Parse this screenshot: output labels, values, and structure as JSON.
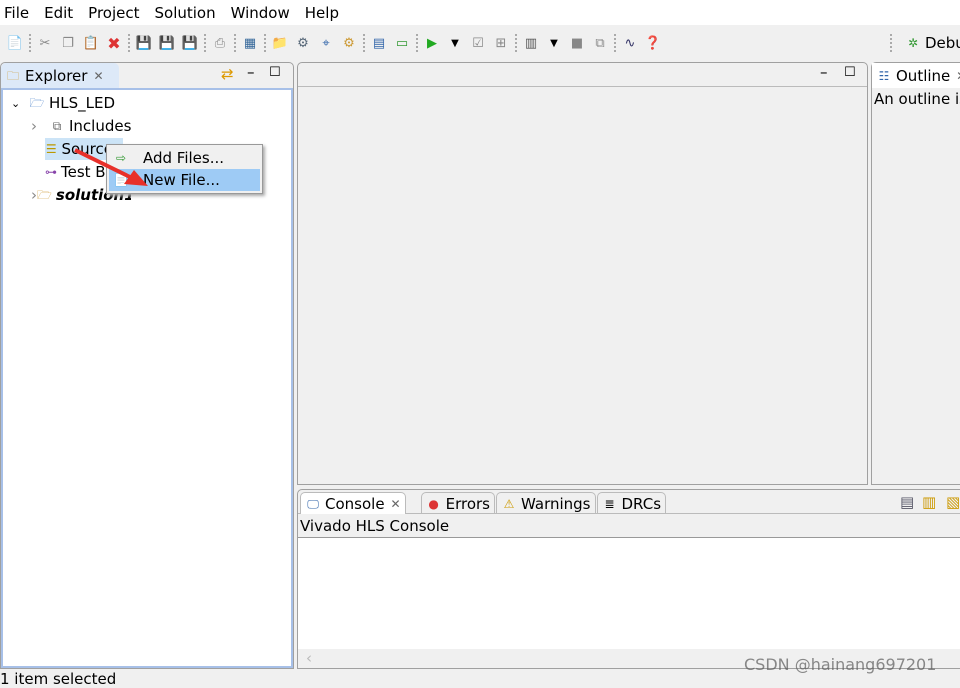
{
  "menu": [
    "File",
    "Edit",
    "Project",
    "Solution",
    "Window",
    "Help"
  ],
  "toolbar": {
    "debug_label": "Debu",
    "icons": [
      "new-file-icon",
      "cut-icon",
      "copy-icon",
      "paste-icon",
      "delete-icon",
      "save-icon",
      "save-all-icon",
      "save-as-icon",
      "print-icon",
      "new-project-icon",
      "new-solution-icon",
      "settings-icon",
      "directives-icon",
      "run-icon",
      "synthesis-icon",
      "cosim-icon",
      "play-icon",
      "dropdown-icon",
      "checkbox-icon",
      "grid-icon",
      "export-icon",
      "stop-icon",
      "compare-icon",
      "analysis-icon",
      "help-icon"
    ]
  },
  "explorer": {
    "title": "Explorer",
    "tree": [
      {
        "label": "HLS_LED"
      },
      {
        "label": "Includes"
      },
      {
        "label": "Source"
      },
      {
        "label": "Test Bench"
      },
      {
        "label": "solution1"
      }
    ]
  },
  "context_menu": {
    "items": [
      "Add Files...",
      "New File..."
    ]
  },
  "outline": {
    "title": "Outline",
    "message": "An outline is"
  },
  "console": {
    "tabs": [
      "Console",
      "Errors",
      "Warnings",
      "DRCs"
    ],
    "header": "Vivado HLS Console"
  },
  "status": "1 item selected",
  "watermark": "CSDN @hainang697201",
  "colors": {
    "selection": "#99c9f5",
    "menu_highlight": "#9ecbf5",
    "arrow": "#e8302a",
    "tree_border": "#a7c0e8"
  }
}
